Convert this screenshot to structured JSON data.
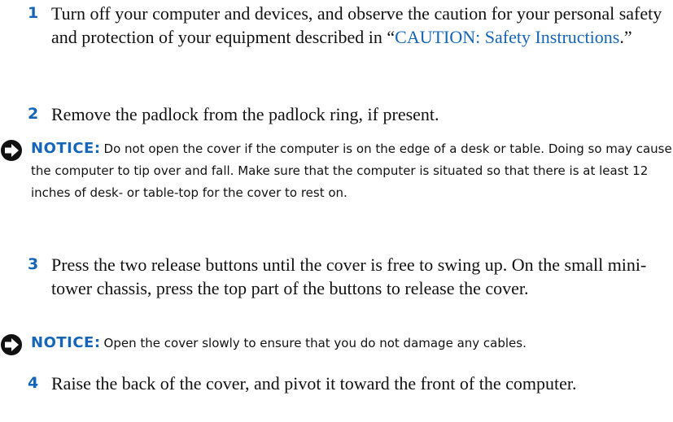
{
  "colors": {
    "accent": "#1565b8",
    "text": "#111111"
  },
  "steps": [
    {
      "number": "1",
      "text_before": "Turn off your computer and devices, and observe the caution for your personal safety and protection of your equipment described in “",
      "link": "CAUTION: Safety Instructions",
      "text_after": ".”"
    },
    {
      "number": "2",
      "text": "Remove the padlock from the padlock ring, if present."
    },
    {
      "number": "3",
      "text": "Press the two release buttons until the cover is free to swing up. On the small mini-tower chassis, press the top part of the buttons to release the cover."
    },
    {
      "number": "4",
      "text": "Raise the back of the cover, and pivot it toward the front of the computer."
    }
  ],
  "notices": [
    {
      "icon": "arrow-right-circle-icon",
      "label": "NOTICE:",
      "text": "Do not open the cover if the computer is on the edge of a desk or table. Doing so may cause the computer to tip over and fall. Make sure that the computer is situated so that there is at least 12 inches of desk- or table-top for the cover to rest on."
    },
    {
      "icon": "arrow-right-circle-icon",
      "label": "NOTICE:",
      "text": "Open the cover slowly to ensure that you do not damage any cables."
    }
  ]
}
